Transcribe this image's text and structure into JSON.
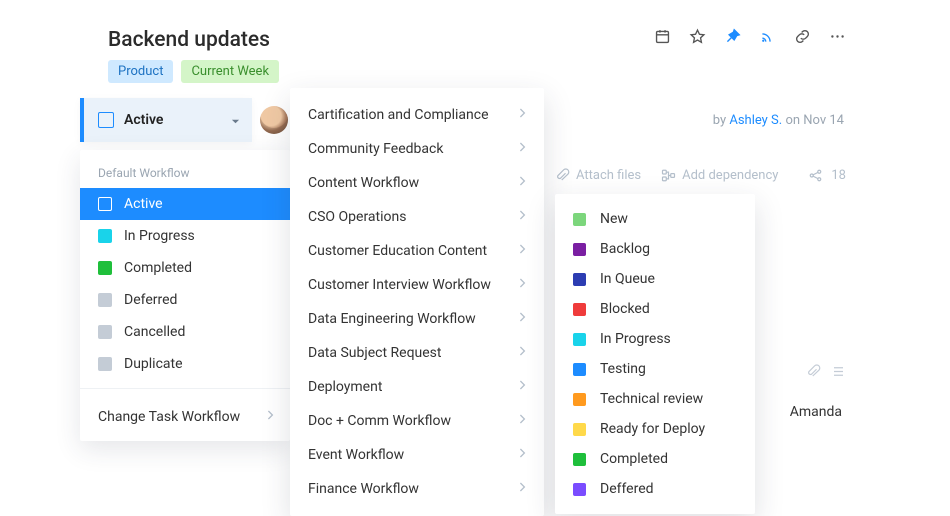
{
  "page": {
    "title": "Backend updates",
    "by_prefix": "by ",
    "author": "Ashley S.",
    "date": " on Nov 14",
    "attach": "Attach files",
    "add_dep": "Add dependency",
    "share_count": "18",
    "assignee": "Amanda"
  },
  "tags": {
    "product": "Product",
    "week": "Current Week"
  },
  "status_pill": {
    "label": "Active"
  },
  "panel1": {
    "header": "Default Workflow",
    "items": [
      {
        "label": "Active",
        "color": "transparent"
      },
      {
        "label": "In Progress",
        "color": "#19d3ea"
      },
      {
        "label": "Completed",
        "color": "#1fbf3b"
      },
      {
        "label": "Deferred",
        "color": "#c4ccd6"
      },
      {
        "label": "Cancelled",
        "color": "#c4ccd6"
      },
      {
        "label": "Duplicate",
        "color": "#c4ccd6"
      }
    ],
    "change": "Change Task Workflow"
  },
  "panel2": {
    "workflows": [
      "Cartification and Compliance",
      "Community Feedback",
      "Content Workflow",
      "CSO Operations",
      "Customer Education Content",
      "Customer Interview Workflow",
      "Data Engineering Workflow",
      "Data Subject Request",
      "Deployment",
      "Doc + Comm Workflow",
      "Event Workflow",
      "Finance Workflow"
    ]
  },
  "panel3": {
    "statuses": [
      {
        "label": "New",
        "color": "#7cd67c"
      },
      {
        "label": "Backlog",
        "color": "#7a1fa2"
      },
      {
        "label": "In Queue",
        "color": "#2c3db2"
      },
      {
        "label": "Blocked",
        "color": "#ef3b3b"
      },
      {
        "label": "In Progress",
        "color": "#19d3ea"
      },
      {
        "label": "Testing",
        "color": "#1d8cff"
      },
      {
        "label": "Technical review",
        "color": "#ff9a1f"
      },
      {
        "label": "Ready for Deploy",
        "color": "#ffd94a"
      },
      {
        "label": "Completed",
        "color": "#1fbf3b"
      },
      {
        "label": "Deffered",
        "color": "#7a4cff"
      }
    ]
  }
}
